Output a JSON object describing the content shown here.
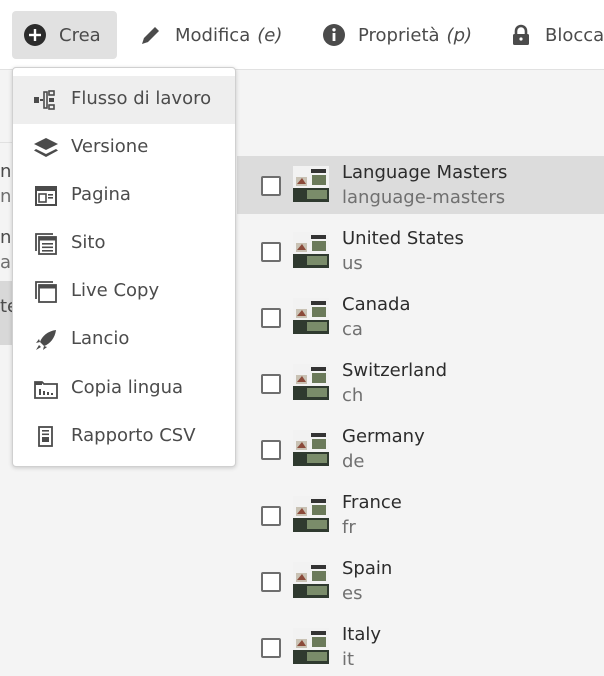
{
  "toolbar": {
    "create": {
      "label": "Crea",
      "icon": "plus-circle-icon"
    },
    "edit": {
      "label": "Modifica",
      "shortcut": "(e)",
      "icon": "pencil-icon"
    },
    "properties": {
      "label": "Proprietà",
      "shortcut": "(p)",
      "icon": "info-icon"
    },
    "lock": {
      "label": "Blocca",
      "icon": "lock-icon"
    }
  },
  "create_menu": {
    "items": [
      {
        "label": "Flusso di lavoro",
        "icon": "workflow-icon"
      },
      {
        "label": "Versione",
        "icon": "layers-icon"
      },
      {
        "label": "Pagina",
        "icon": "page-icon"
      },
      {
        "label": "Sito",
        "icon": "site-icon"
      },
      {
        "label": "Live Copy",
        "icon": "live-copy-icon"
      },
      {
        "label": "Lancio",
        "icon": "launch-icon"
      },
      {
        "label": "Copia lingua",
        "icon": "language-copy-icon"
      },
      {
        "label": "Rapporto CSV",
        "icon": "csv-report-icon"
      }
    ]
  },
  "left_column": {
    "fragments": [
      "ns",
      "ns",
      "np",
      "ap",
      "te"
    ]
  },
  "pages": [
    {
      "title": "Language Masters",
      "name": "language-masters"
    },
    {
      "title": "United States",
      "name": "us"
    },
    {
      "title": "Canada",
      "name": "ca"
    },
    {
      "title": "Switzerland",
      "name": "ch"
    },
    {
      "title": "Germany",
      "name": "de"
    },
    {
      "title": "France",
      "name": "fr"
    },
    {
      "title": "Spain",
      "name": "es"
    },
    {
      "title": "Italy",
      "name": "it"
    }
  ],
  "colors": {
    "accent": "#2c2c2c",
    "selected_row": "#dcdcdc",
    "toolbar_active": "#e1e1e1"
  }
}
